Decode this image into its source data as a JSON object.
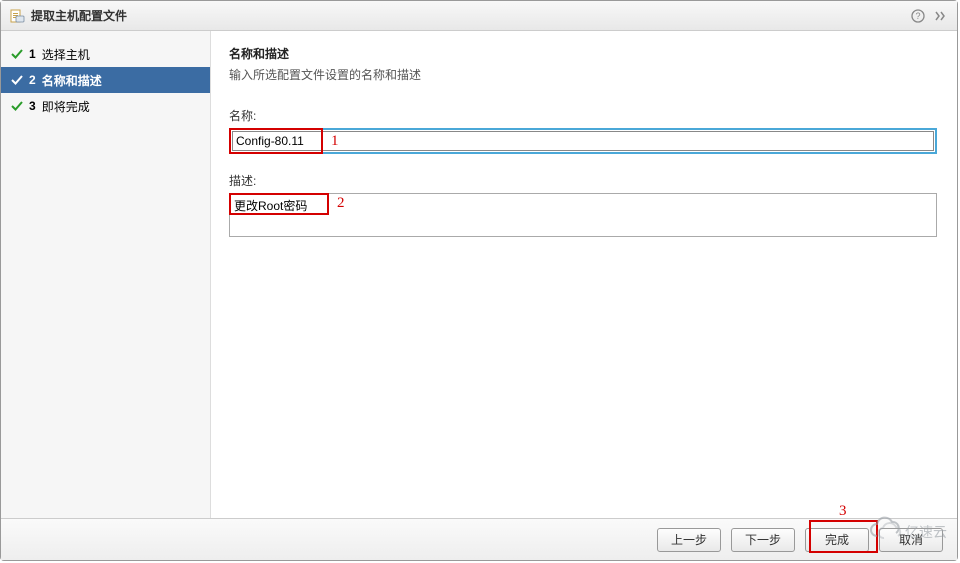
{
  "dialog": {
    "title": "提取主机配置文件"
  },
  "steps": [
    {
      "num": "1",
      "label": "选择主机",
      "checked": true,
      "active": false
    },
    {
      "num": "2",
      "label": "名称和描述",
      "checked": true,
      "active": true
    },
    {
      "num": "3",
      "label": "即将完成",
      "checked": true,
      "active": false
    }
  ],
  "main": {
    "heading": "名称和描述",
    "subheading": "输入所选配置文件设置的名称和描述",
    "name_label": "名称:",
    "name_value": "Config-80.11",
    "desc_label": "描述:",
    "desc_value": "更改Root密码"
  },
  "annotations": {
    "a1": "1",
    "a2": "2",
    "a3": "3"
  },
  "footer": {
    "prev": "上一步",
    "next": "下一步",
    "finish": "完成",
    "cancel": "取消"
  },
  "watermark": {
    "text": "亿速云"
  }
}
